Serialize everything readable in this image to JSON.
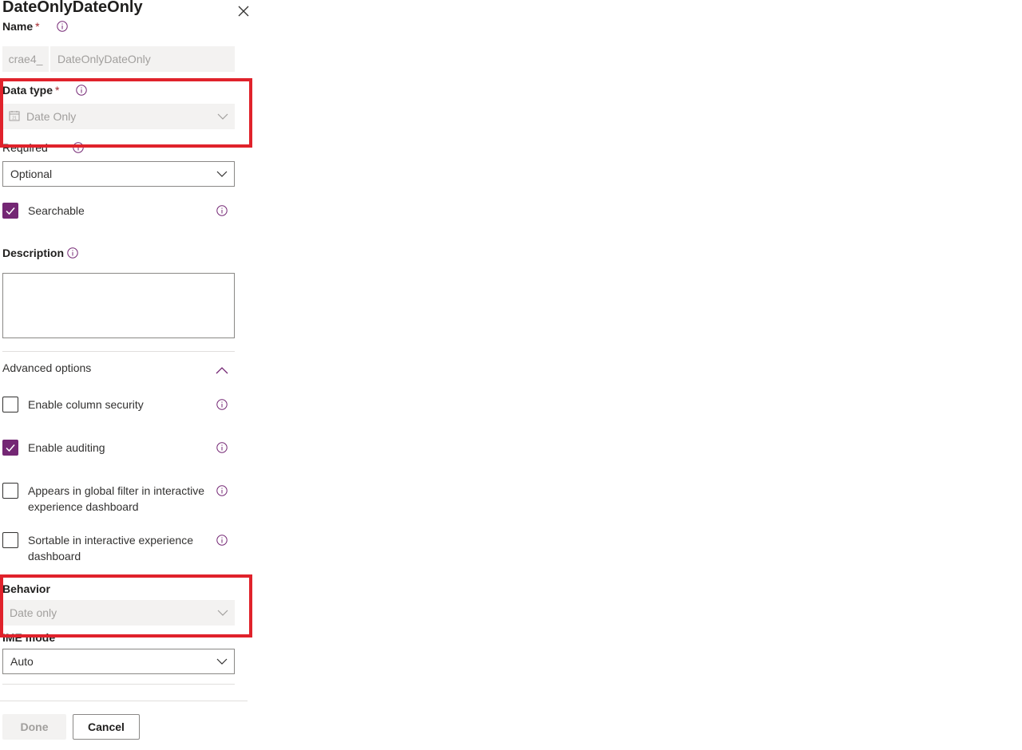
{
  "panel": {
    "title": "DateOnlyDateOnly",
    "close_icon": "close-icon"
  },
  "name_field": {
    "label": "Name",
    "required_mark": "*",
    "prefix": "crae4_",
    "value": "DateOnlyDateOnly"
  },
  "data_type": {
    "label": "Data type",
    "required_mark": "*",
    "icon": "calendar-icon",
    "value": "Date Only"
  },
  "required": {
    "label": "Required",
    "value": "Optional"
  },
  "searchable": {
    "label": "Searchable",
    "checked": true
  },
  "description": {
    "label": "Description",
    "value": ""
  },
  "advanced": {
    "label": "Advanced options",
    "expanded": true,
    "options": [
      {
        "label": "Enable column security",
        "checked": false
      },
      {
        "label": "Enable auditing",
        "checked": true
      },
      {
        "label_line1": "Appears in global filter in interactive",
        "label_line2": "experience dashboard",
        "checked": false
      },
      {
        "label_line1": "Sortable in interactive experience",
        "label_line2": "dashboard",
        "checked": false
      }
    ]
  },
  "behavior": {
    "label": "Behavior",
    "value": "Date only"
  },
  "ime_mode": {
    "label": "IME mode",
    "value": "Auto"
  },
  "buttons": {
    "done": "Done",
    "cancel": "Cancel"
  },
  "colors": {
    "accent": "#742774",
    "highlight_box": "#e0222b",
    "disabled_bg": "#f3f2f1"
  }
}
